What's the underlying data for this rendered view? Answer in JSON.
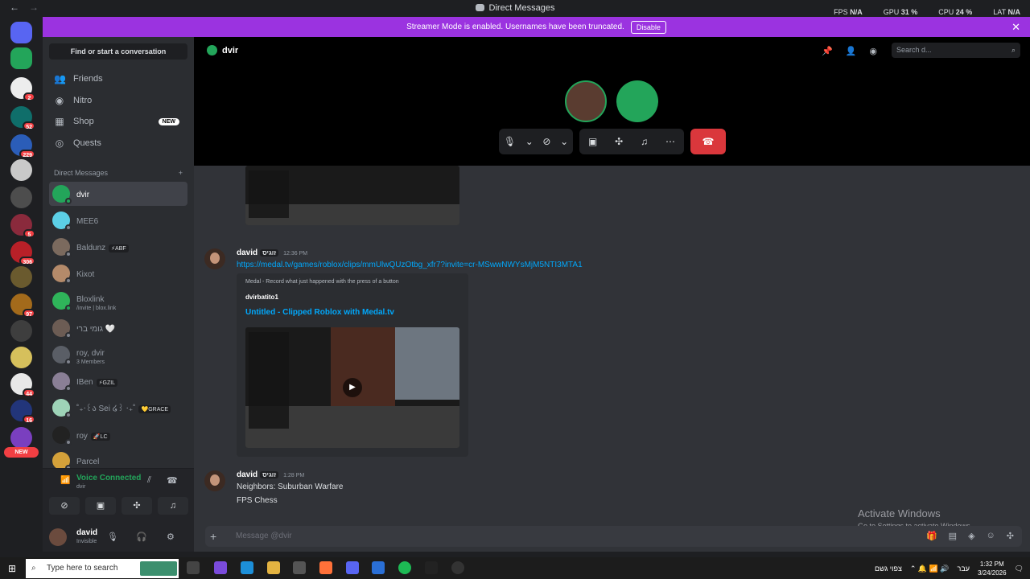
{
  "window": {
    "title": "Direct Messages",
    "back": "←",
    "forward": "→"
  },
  "overlay": {
    "fps_label": "FPS",
    "fps": "N/A",
    "gpu_label": "GPU",
    "gpu": "31 %",
    "cpu_label": "CPU",
    "cpu": "24 %",
    "lat_label": "LAT",
    "lat": "N/A"
  },
  "banner": {
    "text": "Streamer Mode is enabled. Usernames have been truncated.",
    "button": "Disable",
    "close": "✕"
  },
  "guilds": [
    {
      "color": "#5865f2",
      "badge": ""
    },
    {
      "color": "#23a55a",
      "badge": ""
    },
    {
      "color": "#ededed",
      "badge": "2"
    },
    {
      "color": "#0f6e6a",
      "badge": "52"
    },
    {
      "color": "#2b5db8",
      "badge": "229"
    },
    {
      "color": "#c9c9c9",
      "badge": ""
    },
    {
      "color": "#4d4d4d",
      "badge": ""
    },
    {
      "color": "#8a2a3c",
      "badge": "5"
    },
    {
      "color": "#b82028",
      "badge": "306"
    },
    {
      "color": "#6a5a2e",
      "badge": ""
    },
    {
      "color": "#a36a1b",
      "badge": "97"
    },
    {
      "color": "#3e3e3e",
      "badge": ""
    },
    {
      "color": "#d6c05c",
      "badge": ""
    },
    {
      "color": "#e8e8e8",
      "badge": "44"
    },
    {
      "color": "#22357a",
      "badge": "16"
    },
    {
      "color": "#7a3fbf",
      "badge": ""
    }
  ],
  "guild_new": "NEW",
  "sidebar": {
    "search": "Find or start a conversation",
    "nav": [
      {
        "label": "Friends",
        "icon": "👥"
      },
      {
        "label": "Nitro",
        "icon": "◉"
      },
      {
        "label": "Shop",
        "icon": "▦",
        "badge": "NEW"
      },
      {
        "label": "Quests",
        "icon": "◎"
      }
    ],
    "dm_header": "Direct Messages",
    "dm_add": "+",
    "dms": [
      {
        "name": "dvir",
        "sub": "",
        "tag": "",
        "color": "#23a55a",
        "online": true,
        "active": true
      },
      {
        "name": "MEE6",
        "sub": "",
        "tag": "",
        "color": "#5ccfe6",
        "online": false
      },
      {
        "name": "Baldunz",
        "sub": "",
        "tag": "⚡ABF",
        "color": "#7b6a5e",
        "online": false
      },
      {
        "name": "Kixot",
        "sub": "",
        "tag": "",
        "color": "#b48a6a",
        "online": false
      },
      {
        "name": "Bloxlink",
        "sub": "/invite | blox.link",
        "tag": "",
        "color": "#2fb45a",
        "online": true
      },
      {
        "name": "גומי ברי 🤍",
        "sub": "",
        "tag": "",
        "color": "#6c5c54",
        "online": false
      },
      {
        "name": "roy, dvir",
        "sub": "3 Members",
        "tag": "",
        "color": "#5a5e66",
        "online": false
      },
      {
        "name": "IBen",
        "sub": "",
        "tag": "⚡GZIL",
        "color": "#8a7f96",
        "online": false
      },
      {
        "name": "˚₊‧꒰ა Sei ໒꒱ ‧₊˚",
        "sub": "",
        "tag": "💛GRACE",
        "color": "#9ed3b8",
        "online": false
      },
      {
        "name": "roy",
        "sub": "",
        "tag": "🚀LC",
        "color": "#222",
        "online": false
      },
      {
        "name": "Parcel",
        "sub": "",
        "tag": "",
        "color": "#d4a13a",
        "online": false
      }
    ]
  },
  "voice": {
    "status": "Voice Connected",
    "channel": "dvir"
  },
  "user": {
    "name": "david",
    "status": "Invisible"
  },
  "call": {
    "channel": "dvir",
    "search_placeholder": "Search d..."
  },
  "messages": [
    {
      "author": "david",
      "clan": "זוגיס",
      "time": "12:36 PM",
      "link": "https://medal.tv/games/roblox/clips/mmUlwQUzOtbg_xfr7?invite=cr-MSwwNWYsMjM5NTI3MTA1",
      "embed": {
        "provider": "Medal - Record what just happened with the press of a button",
        "author": "dvirbatito1",
        "title": "Untitled - Clipped Roblox with Medal.tv"
      }
    },
    {
      "author": "david",
      "clan": "זוגיס",
      "time": "1:28 PM",
      "lines": [
        "Neighbors: Suburban Warfare",
        "FPS Chess"
      ]
    }
  ],
  "activate": {
    "title": "Activate Windows",
    "sub": "Go to Settings to activate Windows."
  },
  "composer": {
    "placeholder": "Message @dvir",
    "plus": "+"
  },
  "taskbar": {
    "search": "Type here to search",
    "tray_lang": "עבר",
    "weather": "צפוי גשם",
    "time": "1:32 PM",
    "date": "3/24/2026"
  }
}
